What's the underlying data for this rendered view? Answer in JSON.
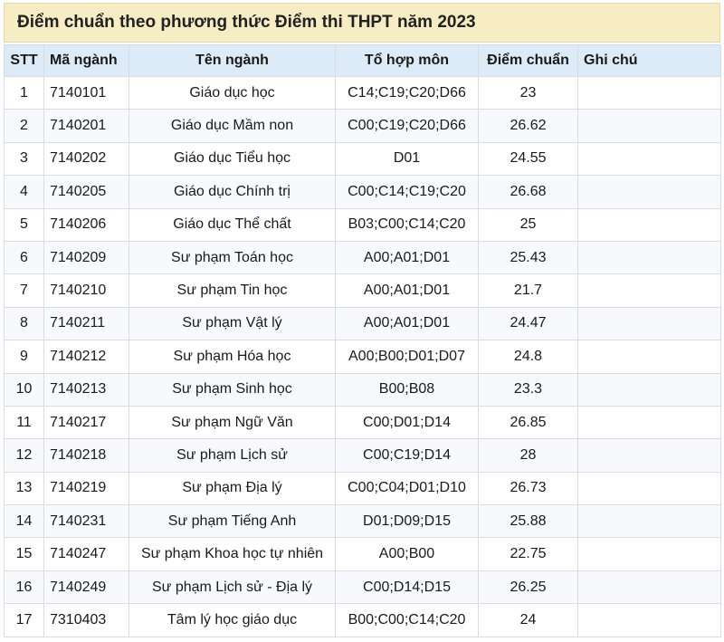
{
  "title": "Điểm chuẩn theo phương thức Điểm thi THPT năm 2023",
  "headers": {
    "stt": "STT",
    "ma": "Mã ngành",
    "ten": "Tên ngành",
    "to": "Tổ hợp môn",
    "diem": "Điểm chuẩn",
    "ghi": "Ghi chú"
  },
  "rows": [
    {
      "stt": "1",
      "ma": "7140101",
      "ten": "Giáo dục học",
      "to": "C14;C19;C20;D66",
      "diem": "23",
      "ghi": ""
    },
    {
      "stt": "2",
      "ma": "7140201",
      "ten": "Giáo dục Mầm non",
      "to": "C00;C19;C20;D66",
      "diem": "26.62",
      "ghi": ""
    },
    {
      "stt": "3",
      "ma": "7140202",
      "ten": "Giáo dục Tiểu học",
      "to": "D01",
      "diem": "24.55",
      "ghi": ""
    },
    {
      "stt": "4",
      "ma": "7140205",
      "ten": "Giáo dục Chính trị",
      "to": "C00;C14;C19;C20",
      "diem": "26.68",
      "ghi": ""
    },
    {
      "stt": "5",
      "ma": "7140206",
      "ten": "Giáo dục Thể chất",
      "to": "B03;C00;C14;C20",
      "diem": "25",
      "ghi": ""
    },
    {
      "stt": "6",
      "ma": "7140209",
      "ten": "Sư phạm Toán học",
      "to": "A00;A01;D01",
      "diem": "25.43",
      "ghi": ""
    },
    {
      "stt": "7",
      "ma": "7140210",
      "ten": "Sư phạm Tin học",
      "to": "A00;A01;D01",
      "diem": "21.7",
      "ghi": ""
    },
    {
      "stt": "8",
      "ma": "7140211",
      "ten": "Sư phạm Vật lý",
      "to": "A00;A01;D01",
      "diem": "24.47",
      "ghi": ""
    },
    {
      "stt": "9",
      "ma": "7140212",
      "ten": "Sư phạm Hóa học",
      "to": "A00;B00;D01;D07",
      "diem": "24.8",
      "ghi": ""
    },
    {
      "stt": "10",
      "ma": "7140213",
      "ten": "Sư phạm Sinh học",
      "to": "B00;B08",
      "diem": "23.3",
      "ghi": ""
    },
    {
      "stt": "11",
      "ma": "7140217",
      "ten": "Sư phạm Ngữ Văn",
      "to": "C00;D01;D14",
      "diem": "26.85",
      "ghi": ""
    },
    {
      "stt": "12",
      "ma": "7140218",
      "ten": "Sư phạm Lịch sử",
      "to": "C00;C19;D14",
      "diem": "28",
      "ghi": ""
    },
    {
      "stt": "13",
      "ma": "7140219",
      "ten": "Sư phạm Địa lý",
      "to": "C00;C04;D01;D10",
      "diem": "26.73",
      "ghi": ""
    },
    {
      "stt": "14",
      "ma": "7140231",
      "ten": "Sư phạm Tiếng Anh",
      "to": "D01;D09;D15",
      "diem": "25.88",
      "ghi": ""
    },
    {
      "stt": "15",
      "ma": "7140247",
      "ten": "Sư phạm Khoa học tự nhiên",
      "to": "A00;B00",
      "diem": "22.75",
      "ghi": ""
    },
    {
      "stt": "16",
      "ma": "7140249",
      "ten": "Sư phạm Lịch sử - Địa lý",
      "to": "C00;D14;D15",
      "diem": "26.25",
      "ghi": ""
    },
    {
      "stt": "17",
      "ma": "7310403",
      "ten": "Tâm lý học giáo dục",
      "to": "B00;C00;C14;C20",
      "diem": "24",
      "ghi": ""
    }
  ]
}
